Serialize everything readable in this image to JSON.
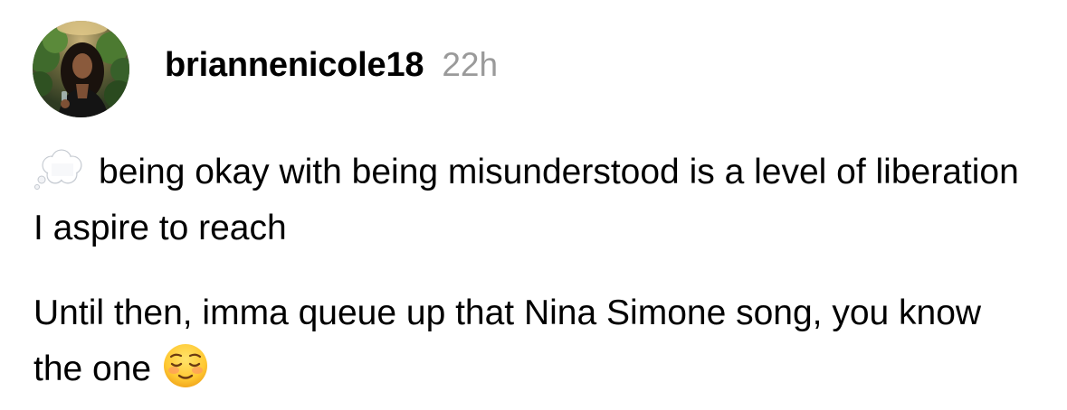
{
  "post": {
    "author": {
      "username": "briannenicole18",
      "avatar_icon": "profile-photo",
      "timestamp": "22h"
    },
    "paragraphs": [
      {
        "leading_emoji": "thought-balloon-icon",
        "text": "being okay with being misunderstood is a level of liberation I aspire to reach"
      },
      {
        "text": "Until then, imma queue up that Nina Simone song, you know the one",
        "trailing_emoji": "relieved-face-icon"
      }
    ]
  },
  "colors": {
    "text": "#000000",
    "timestamp": "#9a9a9a",
    "background": "#ffffff"
  }
}
